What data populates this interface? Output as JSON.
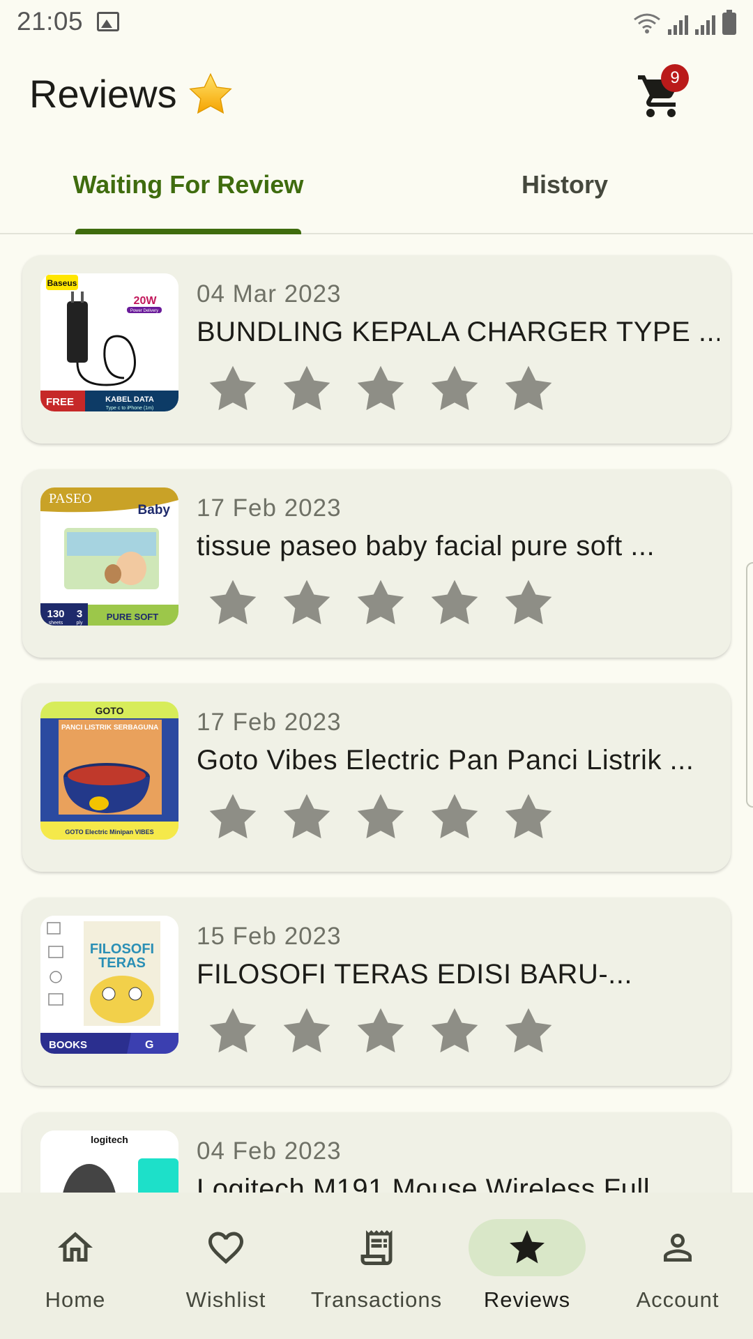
{
  "status_bar": {
    "time": "21:05"
  },
  "header": {
    "title": "Reviews",
    "cart_count": "9"
  },
  "tabs": [
    {
      "label": "Waiting For Review",
      "active": true
    },
    {
      "label": "History",
      "active": false
    }
  ],
  "reviews": [
    {
      "date": "04 Mar 2023",
      "title": "BUNDLING KEPALA CHARGER TYPE ...",
      "rating": 0,
      "thumb": {
        "brand": "Baseus",
        "badge": "20W",
        "sub": "Power Delivery",
        "footer_left": "FREE",
        "footer_right": "KABEL DATA",
        "footer_small": "Type c to iPhone (1m)"
      }
    },
    {
      "date": "17 Feb 2023",
      "title": "tissue paseo baby facial pure soft ...",
      "rating": 0,
      "thumb": {
        "brand": "PASEO",
        "tag": "Baby",
        "count": "130",
        "count_unit": "sheets",
        "ply": "3",
        "ply_unit": "ply",
        "footer": "PURE SOFT"
      }
    },
    {
      "date": "17 Feb 2023",
      "title": "Goto Vibes Electric Pan Panci Listrik ...",
      "rating": 0,
      "thumb": {
        "brand": "GOTO",
        "banner": "PANCI LISTRIK SERBAGUNA",
        "footer": "GOTO Electric Minipan VIBES"
      }
    },
    {
      "date": "15 Feb 2023",
      "title": "FILOSOFI TERAS EDISI BARU-...",
      "rating": 0,
      "thumb": {
        "book_title_1": "FILOSOFI",
        "book_title_2": "TERAS",
        "footer": "BOOKS",
        "logo": "G"
      }
    },
    {
      "date": "04 Feb 2023",
      "title": "Logitech M191 Mouse Wireless Full",
      "rating": 0,
      "thumb": {
        "brand": "logitech"
      }
    }
  ],
  "bottom_nav": [
    {
      "label": "Home",
      "icon": "home-icon",
      "active": false
    },
    {
      "label": "Wishlist",
      "icon": "heart-icon",
      "active": false
    },
    {
      "label": "Transactions",
      "icon": "receipt-icon",
      "active": false
    },
    {
      "label": "Reviews",
      "icon": "star-icon",
      "active": true
    },
    {
      "label": "Account",
      "icon": "person-icon",
      "active": false
    }
  ],
  "colors": {
    "primary": "#3f6c0e",
    "background": "#fbfbf2",
    "card": "#f0f1e6",
    "star_empty": "#8e8e86",
    "badge": "#ba1a1a",
    "nav_active_pill": "#d9e7c8"
  }
}
